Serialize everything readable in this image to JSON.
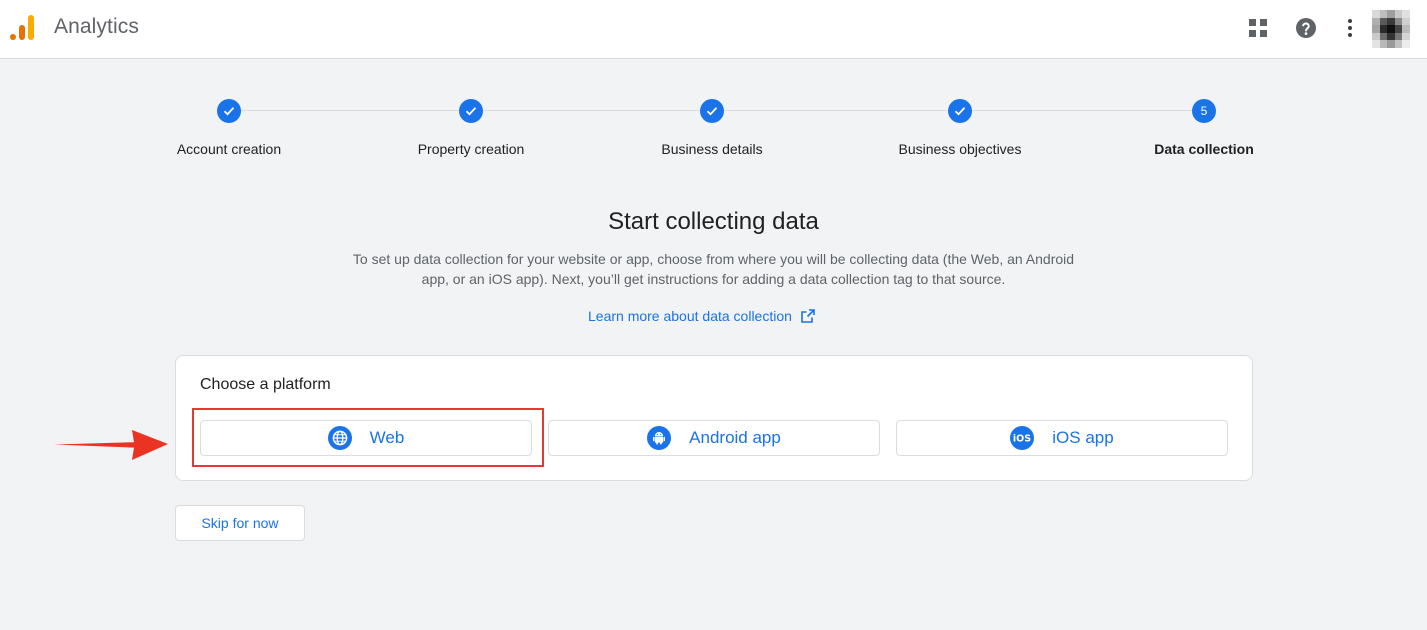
{
  "header": {
    "app_title": "Analytics",
    "icons": [
      "analytics-logo",
      "apps-grid-icon",
      "help-icon",
      "more-vert-icon",
      "avatar"
    ]
  },
  "stepper": {
    "steps": [
      {
        "label": "Account creation",
        "state": "complete"
      },
      {
        "label": "Property creation",
        "state": "complete"
      },
      {
        "label": "Business details",
        "state": "complete"
      },
      {
        "label": "Business objectives",
        "state": "complete"
      },
      {
        "label": "Data collection",
        "state": "active",
        "number": "5"
      }
    ]
  },
  "main": {
    "title": "Start collecting data",
    "description_line1": "To set up data collection for your website or app, choose from where you will be collecting data (the Web, an Android",
    "description_line2": "app, or an iOS app). Next, you’ll get instructions for adding a data collection tag to that source.",
    "learn_more": "Learn more about data collection"
  },
  "platform_card": {
    "title": "Choose a platform",
    "options": [
      {
        "label": "Web",
        "icon": "globe-icon"
      },
      {
        "label": "Android app",
        "icon": "android-icon"
      },
      {
        "label": "iOS app",
        "icon": "ios-icon"
      }
    ],
    "highlighted": "Web"
  },
  "skip_label": "Skip for now",
  "colors": {
    "accent": "#1a73e8",
    "highlight": "#e53935",
    "background": "#f1f3f4"
  }
}
